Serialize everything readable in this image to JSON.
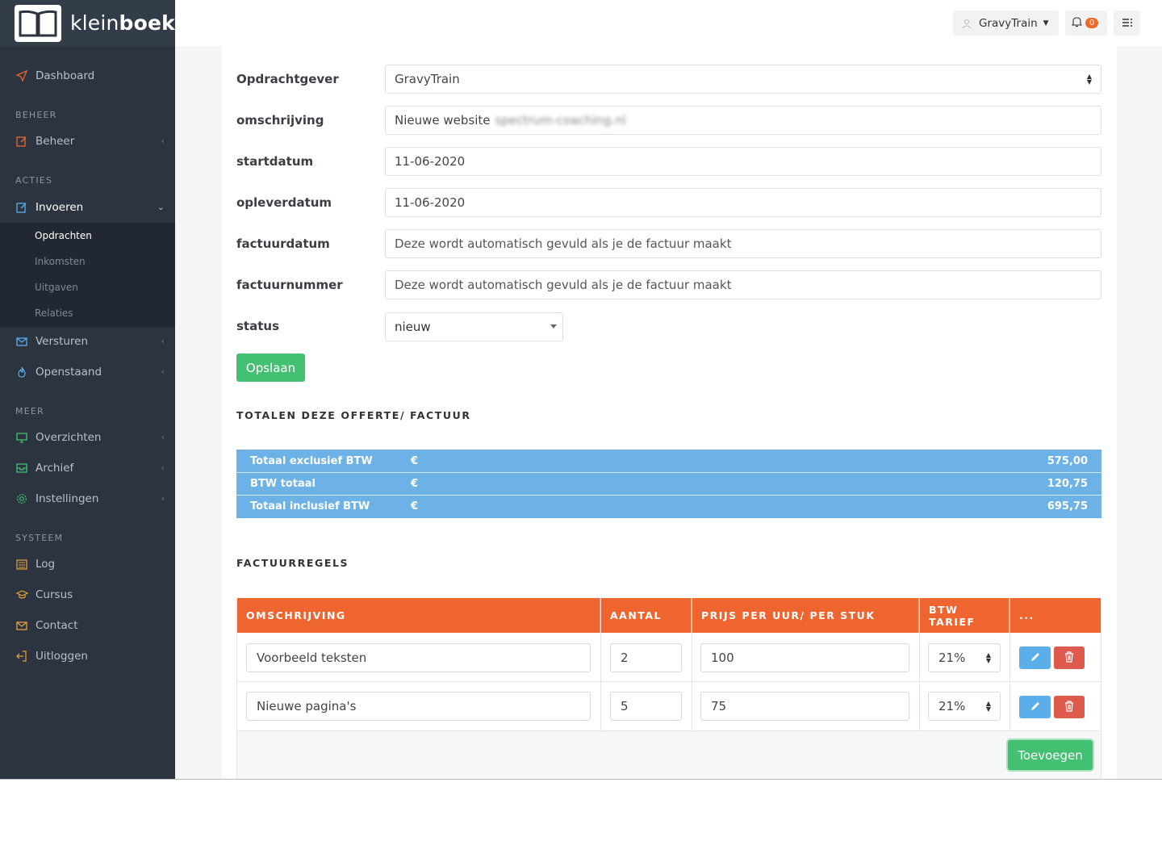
{
  "app": {
    "logo_text_light": "klein",
    "logo_text_bold": "boek"
  },
  "sidebar": {
    "dashboard": "Dashboard",
    "header_beheer": "BEHEER",
    "beheer": "Beheer",
    "header_acties": "ACTIES",
    "invoeren": "Invoeren",
    "sub": [
      "Opdrachten",
      "Inkomsten",
      "Uitgaven",
      "Relaties"
    ],
    "versturen": "Versturen",
    "openstaand": "Openstaand",
    "header_meer": "MEER",
    "overzichten": "Overzichten",
    "archief": "Archief",
    "instellingen": "Instellingen",
    "header_systeem": "SYSTEEM",
    "log": "Log",
    "cursus": "Cursus",
    "contact": "Contact",
    "uitloggen": "Uitloggen"
  },
  "topbar": {
    "user": "GravyTrain",
    "notifications": "0"
  },
  "form": {
    "opdrachtgever_label": "Opdrachtgever",
    "opdrachtgever_value": "GravyTrain",
    "omschrijving_label": "omschrijving",
    "omschrijving_value": "Nieuwe website",
    "omschrijving_blurred": "spectrum-coaching.nl",
    "startdatum_label": "startdatum",
    "startdatum_value": "11-06-2020",
    "opleverdatum_label": "opleverdatum",
    "opleverdatum_value": "11-06-2020",
    "factuurdatum_label": "factuurdatum",
    "factuurdatum_placeholder": "Deze wordt automatisch gevuld als je de factuur maakt",
    "factuurnummer_label": "factuurnummer",
    "factuurnummer_placeholder": "Deze wordt automatisch gevuld als je de factuur maakt",
    "status_label": "status",
    "status_value": "nieuw",
    "save_label": "Opslaan"
  },
  "totals": {
    "title": "TOTALEN DEZE OFFERTE/ FACTUUR",
    "rows": [
      {
        "label": "Totaal exclusief BTW",
        "currency": "€",
        "value": "575,00"
      },
      {
        "label": "BTW totaal",
        "currency": "€",
        "value": "120,75"
      },
      {
        "label": "Totaal inclusief BTW",
        "currency": "€",
        "value": "695,75"
      }
    ]
  },
  "lines": {
    "title": "FACTUURREGELS",
    "columns": [
      "OMSCHRIJVING",
      "AANTAL",
      "PRIJS PER UUR/ PER STUK",
      "BTW TARIEF",
      "..."
    ],
    "rows": [
      {
        "omschrijving": "Voorbeeld teksten",
        "aantal": "2",
        "prijs": "100",
        "btw": "21%"
      },
      {
        "omschrijving": "Nieuwe pagina's",
        "aantal": "5",
        "prijs": "75",
        "btw": "21%"
      }
    ],
    "add_label": "Toevoegen"
  },
  "colors": {
    "sidebar": "#2c3440",
    "accent_orange": "#ee6530",
    "totals_blue": "#6db2e6",
    "green": "#43c071",
    "edit_blue": "#5aaeea",
    "delete_red": "#dd5a4c"
  }
}
